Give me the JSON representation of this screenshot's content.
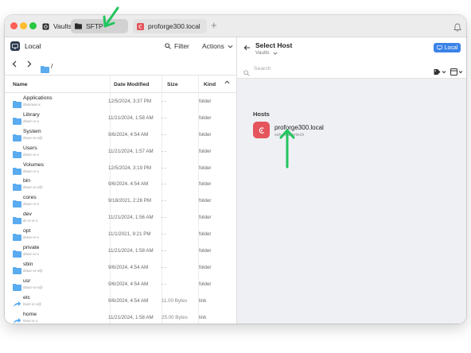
{
  "tabs": [
    {
      "label": "Vaults",
      "icon": "vaults-icon"
    },
    {
      "label": "SFTP",
      "icon": "folder-icon"
    },
    {
      "label": "proforge300.local",
      "icon": "debian-icon"
    }
  ],
  "left_pane": {
    "title": "Local",
    "filter_label": "Filter",
    "actions_label": "Actions",
    "path": "/",
    "columns": [
      "Name",
      "Date Modified",
      "Size",
      "Kind"
    ],
    "files": [
      {
        "name": "Applications",
        "perm": "drwxrwxr-x",
        "date": "12/5/2024, 3:37 PM",
        "size": "- -",
        "kind": "folder",
        "type": "folder"
      },
      {
        "name": "Library",
        "perm": "drwxr-xr-x",
        "date": "11/21/2024, 1:58 AM",
        "size": "- -",
        "kind": "folder",
        "type": "folder"
      },
      {
        "name": "System",
        "perm": "drwxr-xr-x@",
        "date": "9/6/2024, 4:54 AM",
        "size": "- -",
        "kind": "folder",
        "type": "folder"
      },
      {
        "name": "Users",
        "perm": "drwxr-xr-x",
        "date": "11/21/2024, 1:57 AM",
        "size": "- -",
        "kind": "folder",
        "type": "folder"
      },
      {
        "name": "Volumes",
        "perm": "drwxr-xr-x",
        "date": "12/5/2024, 3:19 PM",
        "size": "- -",
        "kind": "folder",
        "type": "folder"
      },
      {
        "name": "bin",
        "perm": "drwxr-xr-x@",
        "date": "9/6/2024, 4:54 AM",
        "size": "- -",
        "kind": "folder",
        "type": "folder"
      },
      {
        "name": "cores",
        "perm": "drwxr-xr-x",
        "date": "9/18/2021, 2:26 PM",
        "size": "- -",
        "kind": "folder",
        "type": "folder"
      },
      {
        "name": "dev",
        "perm": "dr-xr-xr-x",
        "date": "11/21/2024, 1:56 AM",
        "size": "- -",
        "kind": "folder",
        "type": "folder"
      },
      {
        "name": "opt",
        "perm": "drwxr-xr-x",
        "date": "11/1/2021, 9:21 PM",
        "size": "- -",
        "kind": "folder",
        "type": "folder"
      },
      {
        "name": "private",
        "perm": "drwxr-xr-x",
        "date": "11/21/2024, 1:58 AM",
        "size": "- -",
        "kind": "folder",
        "type": "folder"
      },
      {
        "name": "sbin",
        "perm": "drwxr-xr-x@",
        "date": "9/6/2024, 4:54 AM",
        "size": "- -",
        "kind": "folder",
        "type": "folder"
      },
      {
        "name": "usr",
        "perm": "drwxr-xr-x@",
        "date": "9/6/2024, 4:54 AM",
        "size": "- -",
        "kind": "folder",
        "type": "folder"
      },
      {
        "name": "etc",
        "perm": "lrwxr-xr-x@",
        "date": "9/6/2024, 4:54 AM",
        "size": "11.00 Bytes",
        "kind": "link",
        "type": "link"
      },
      {
        "name": "home",
        "perm": "lrwxr-xr-x",
        "date": "11/21/2024, 1:58 AM",
        "size": "25.00 Bytes",
        "kind": "link",
        "type": "link"
      }
    ]
  },
  "right_pane": {
    "title": "Select Host",
    "subtitle": "Vaults",
    "local_button": "Local",
    "search_placeholder": "Search",
    "hosts_label": "Hosts",
    "hosts": [
      {
        "name": "proforge300.local",
        "sub": "ssh, makertech"
      }
    ]
  },
  "colors": {
    "accent": "#3b82e8",
    "host_icon": "#e5545c",
    "folder": "#5aabef",
    "annotation_arrow": "#22c55e"
  }
}
